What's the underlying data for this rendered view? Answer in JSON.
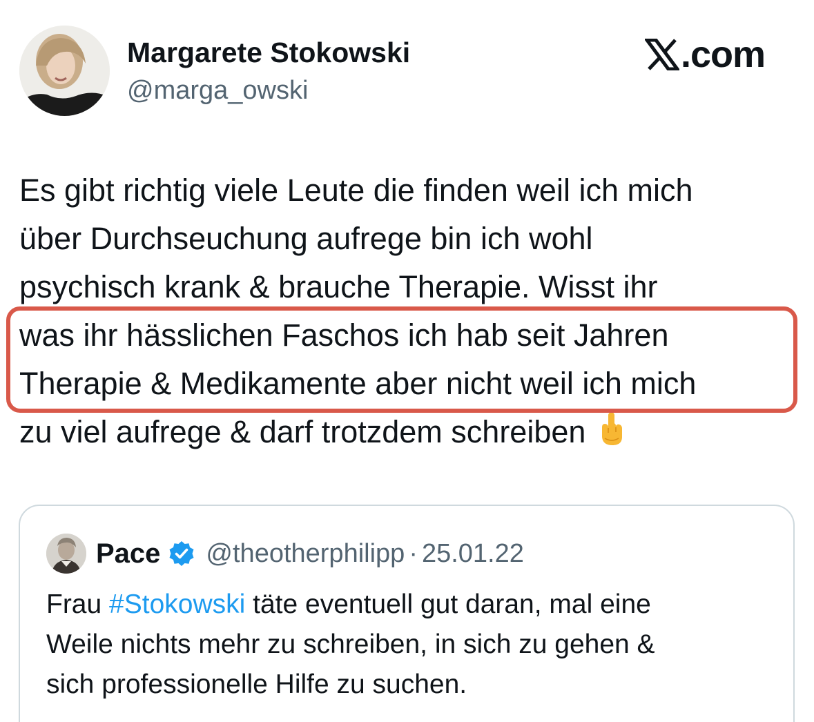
{
  "author": {
    "name": "Margarete Stokowski",
    "handle": "@marga_owski"
  },
  "brand": {
    "text": ".com",
    "icon": "x-logo-icon"
  },
  "tweet": {
    "lines": [
      "Es gibt richtig viele Leute die finden weil ich mich",
      "über Durchseuchung aufrege bin ich wohl",
      "psychisch krank & brauche Therapie. Wisst ihr",
      "was ihr hässlichen Faschos ich hab seit Jahren",
      "Therapie & Medikamente aber nicht weil ich mich",
      "zu viel aufrege & darf trotzdem schreiben"
    ],
    "emoji": "middle-finger-emoji"
  },
  "highlight": {
    "color": "#d9594a"
  },
  "quoted_tweet": {
    "name": "Pace",
    "handle": "@theotherphilipp",
    "separator": "·",
    "date": "25.01.22",
    "verified_icon": "verified-badge-icon",
    "text_prefix": "Frau ",
    "hashtag": "#Stokowski",
    "text_line1_rest": " täte eventuell gut daran, mal eine",
    "text_line2": "Weile nichts mehr zu schreiben, in sich zu gehen &",
    "text_line3": "sich professionelle Hilfe zu suchen."
  },
  "colors": {
    "text": "#0f1419",
    "secondary": "#536471",
    "link": "#1d9bf0",
    "verified": "#1d9bf0",
    "border": "#cfd9de"
  }
}
